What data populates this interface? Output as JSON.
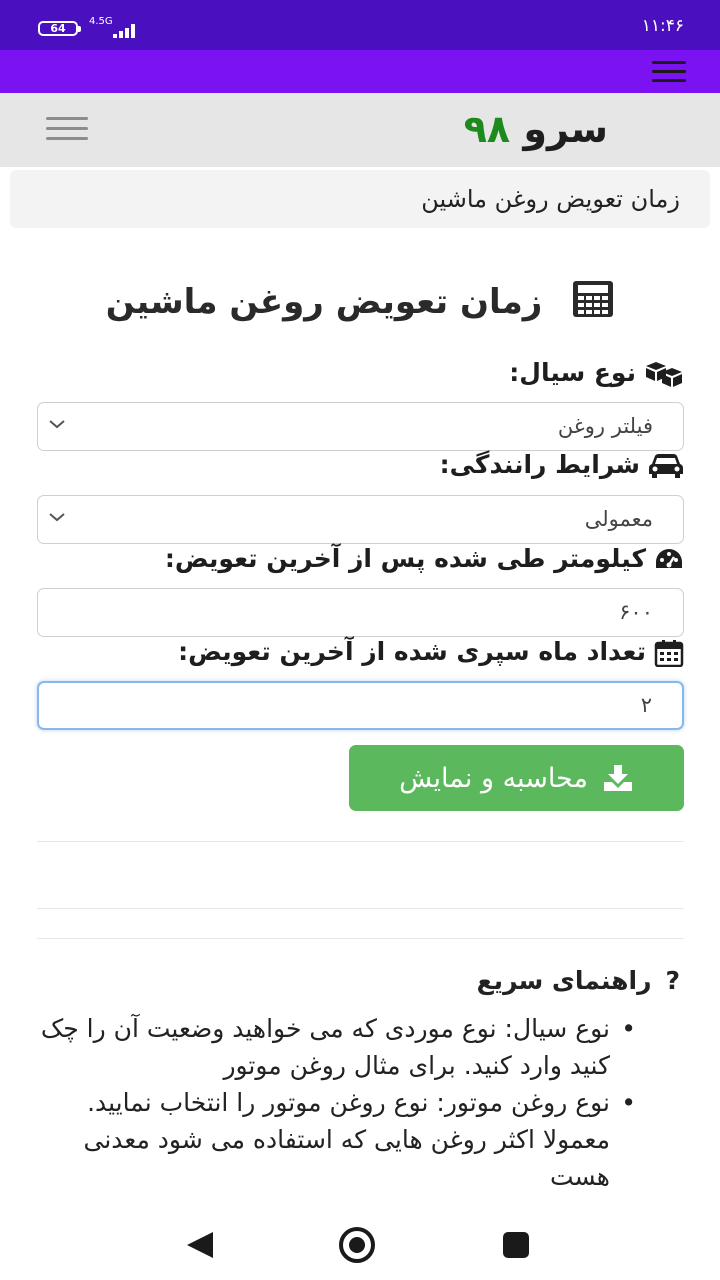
{
  "status_bar": {
    "battery": "64",
    "network": "4.5G",
    "time": "۱۱:۴۶"
  },
  "site": {
    "logo_text": "سرو",
    "logo_number": "۹۸"
  },
  "breadcrumb": "زمان تعویض روغن ماشین",
  "page_title": "زمان تعویض روغن ماشین",
  "form": {
    "fluid_type_label": "نوع سیال:",
    "fluid_type_value": "فیلتر روغن",
    "driving_label": "شرایط رانندگی:",
    "driving_value": "معمولی",
    "km_label": "کیلومتر طی شده پس از آخرین تعویض:",
    "km_value": "۶۰۰",
    "months_label": "تعداد ماه سپری شده از آخرین تعویض:",
    "months_value": "۲",
    "submit_label": "محاسبه و نمایش"
  },
  "help": {
    "title": "راهنمای سریع",
    "items": [
      "نوع سیال: نوع موردی که می خواهید وضعیت آن را چک کنید وارد کنید. برای مثال روغن موتور",
      "نوع روغن موتور: نوع روغن موتور را انتخاب نمایید. معمولا اکثر روغن هایی که استفاده می شود معدنی هست"
    ]
  },
  "colors": {
    "status_bar": "#4a0fbf",
    "app_bar": "#7a12f2",
    "logo_green": "#1d8a1d",
    "submit_button": "#5cb85c"
  }
}
